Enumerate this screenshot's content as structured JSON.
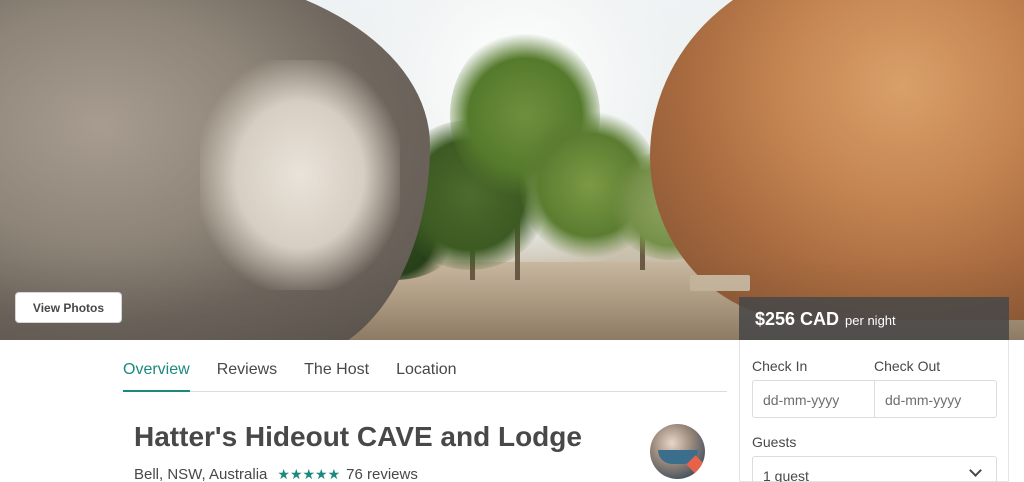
{
  "hero": {
    "view_photos_label": "View Photos",
    "price": {
      "amount": "$256 CAD",
      "unit": "per night"
    }
  },
  "tabs": [
    {
      "label": "Overview",
      "active": true
    },
    {
      "label": "Reviews",
      "active": false
    },
    {
      "label": "The Host",
      "active": false
    },
    {
      "label": "Location",
      "active": false
    }
  ],
  "listing": {
    "title": "Hatter's Hideout CAVE and Lodge",
    "location": "Bell, NSW, Australia",
    "rating_stars": 5,
    "stars_text": "★★★★★",
    "reviews": "76 reviews"
  },
  "booking": {
    "check_in_label": "Check In",
    "check_out_label": "Check Out",
    "check_in_placeholder": "dd-mm-yyyy",
    "check_out_placeholder": "dd-mm-yyyy",
    "guests_label": "Guests",
    "guests_value": "1 guest"
  },
  "colors": {
    "accent": "#1b8a7e",
    "text": "#484848",
    "price_band": "#484848"
  },
  "icons": {
    "rating": "star-icon",
    "dropdown": "chevron-down-icon"
  }
}
